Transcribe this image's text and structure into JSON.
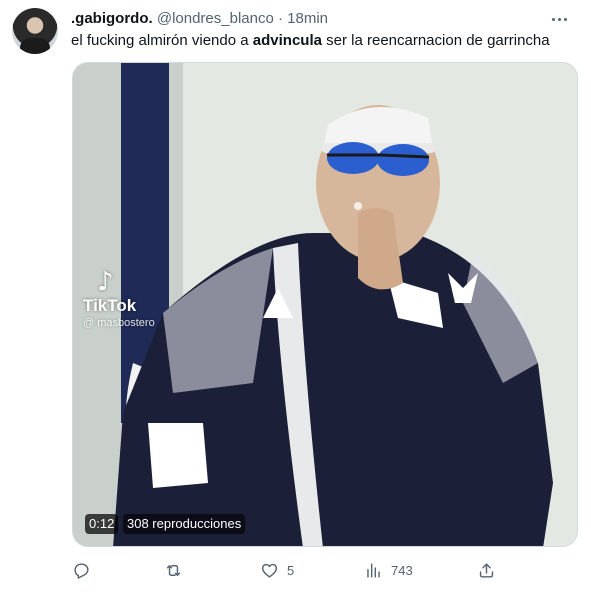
{
  "author": {
    "display_name": ".gabigordo.",
    "handle": "@londres_blanco",
    "separator": "·",
    "time": "18min"
  },
  "tweet": {
    "text_before": "el fucking almirón viendo a ",
    "text_bold": "advincula",
    "text_after": " ser la reencarnacion de garrincha"
  },
  "video": {
    "watermark_brand": "TikTok",
    "watermark_user": "@ masbostero",
    "duration": "0:12",
    "views_label": "308 reproducciones"
  },
  "actions": {
    "reply_count": "",
    "retweet_count": "",
    "like_count": "5",
    "views_count": "743"
  },
  "icons": {
    "more": "more-horizontal-icon",
    "reply": "reply-icon",
    "retweet": "retweet-icon",
    "like": "heart-icon",
    "views": "analytics-icon",
    "share": "share-icon"
  },
  "colors": {
    "text_primary": "#0f1419",
    "text_secondary": "#536471",
    "border": "#cfd9de"
  }
}
